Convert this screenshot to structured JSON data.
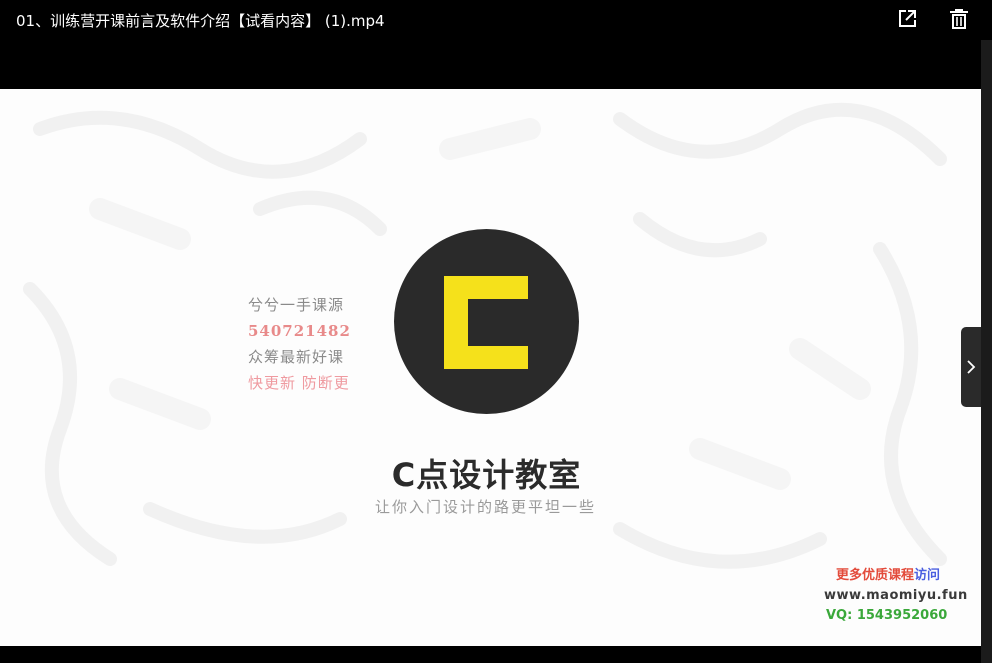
{
  "viewer": {
    "file_title": "01、训练营开课前言及软件介绍【试看内容】 (1).mp4",
    "open_external_icon": "open-in-new-icon",
    "delete_icon": "trash-icon",
    "next_icon": "chevron-right-icon"
  },
  "frame": {
    "brand_name": "C点设计教室",
    "slogan": "让你入门设计的路更平坦一些",
    "logo_colors": {
      "circle": "#2a2a2a",
      "mark": "#f5e11b"
    },
    "watermark_lines": [
      "兮兮一手课源",
      "540721482",
      "众筹最新好课",
      "快更新 防断更"
    ],
    "corner_watermark": {
      "line1": "更多优质课程",
      "line1_link": "访问",
      "line2": "www.maomiyu.fun",
      "line3": "VQ: 1543952060"
    }
  }
}
